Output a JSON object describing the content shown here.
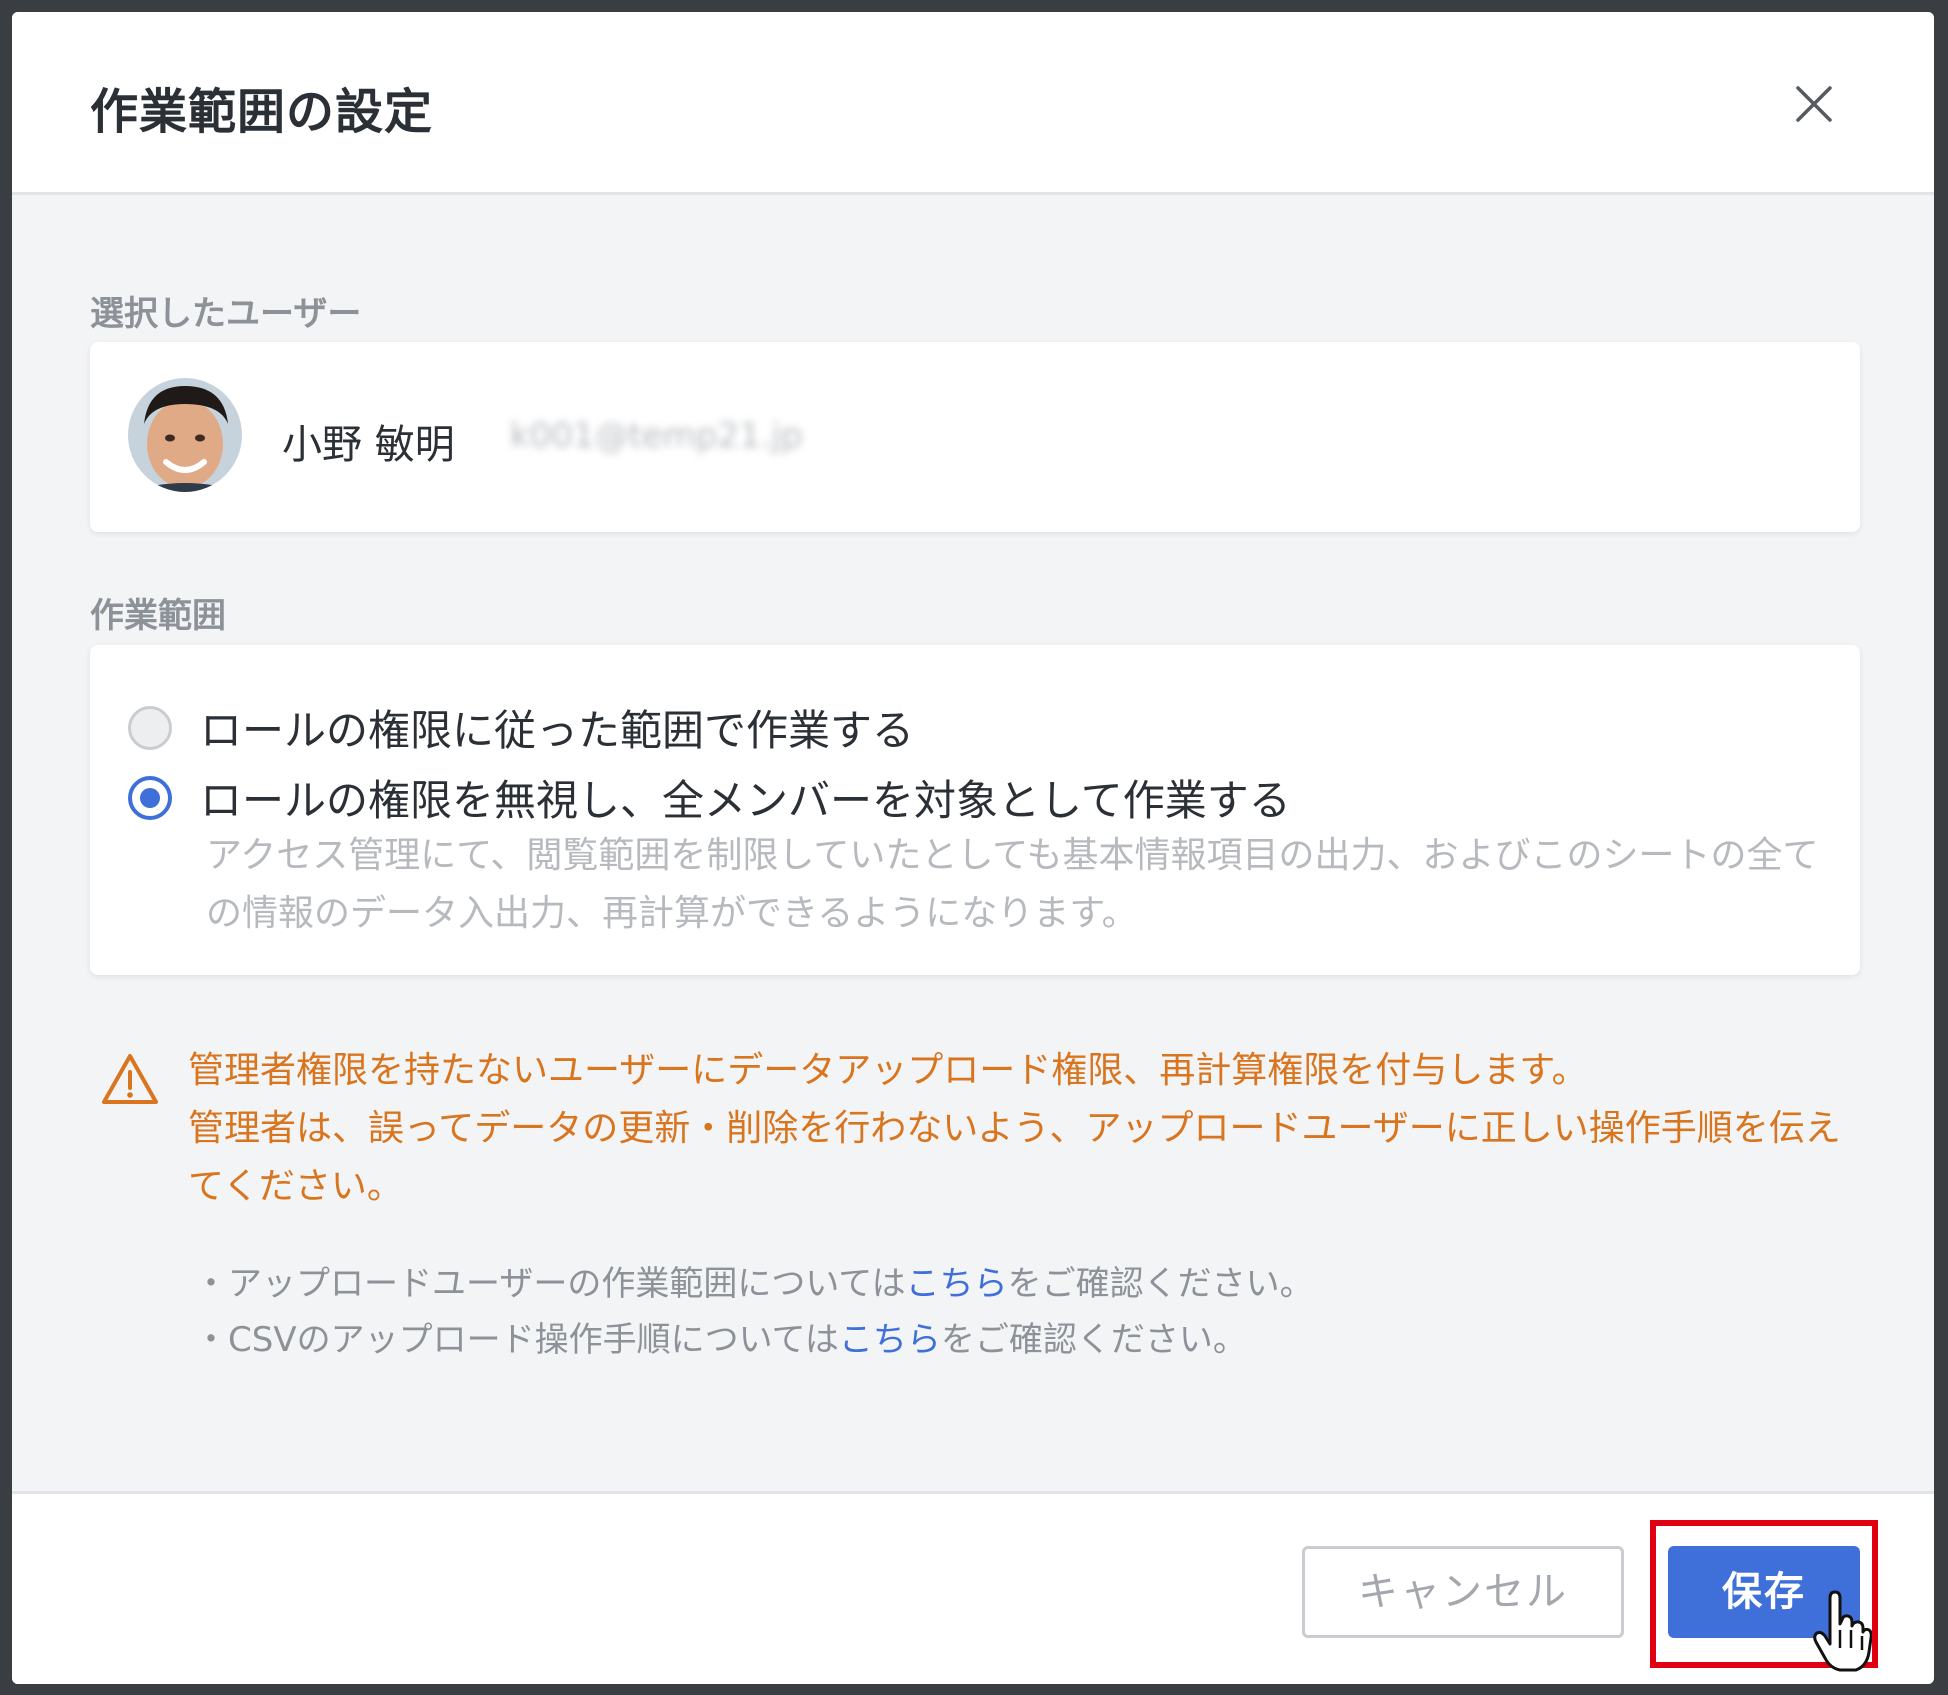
{
  "dialog": {
    "title": "作業範囲の設定",
    "close_icon": "close-icon"
  },
  "selected_user": {
    "label": "選択したユーザー",
    "name": "小野 敏明",
    "email": "k001@temp21.jp"
  },
  "scope": {
    "label": "作業範囲",
    "options": [
      {
        "label": "ロールの権限に従った範囲で作業する",
        "selected": false
      },
      {
        "label": "ロールの権限を無視し、全メンバーを対象として作業する",
        "selected": true
      }
    ],
    "description": "アクセス管理にて、閲覧範囲を制限していたとしても基本情報項目の出力、およびこのシートの全ての情報のデータ入出力、再計算ができるようになります。"
  },
  "warning": {
    "icon": "warning-icon",
    "line1": "管理者権限を持たないユーザーにデータアップロード権限、再計算権限を付与します。",
    "line2": "管理者は、誤ってデータの更新・削除を行わないよう、アップロードユーザーに正しい操作手順を伝えてください。"
  },
  "notes": [
    {
      "prefix": "・アップロードユーザーの作業範囲については",
      "link": "こちら",
      "suffix": "をご確認ください。"
    },
    {
      "prefix": "・CSVのアップロード操作手順については",
      "link": "こちら",
      "suffix": "をご確認ください。"
    }
  ],
  "footer": {
    "cancel_label": "キャンセル",
    "save_label": "保存"
  },
  "colors": {
    "accent": "#3f6fd8",
    "warning": "#d9751f",
    "highlight": "#e00012"
  }
}
